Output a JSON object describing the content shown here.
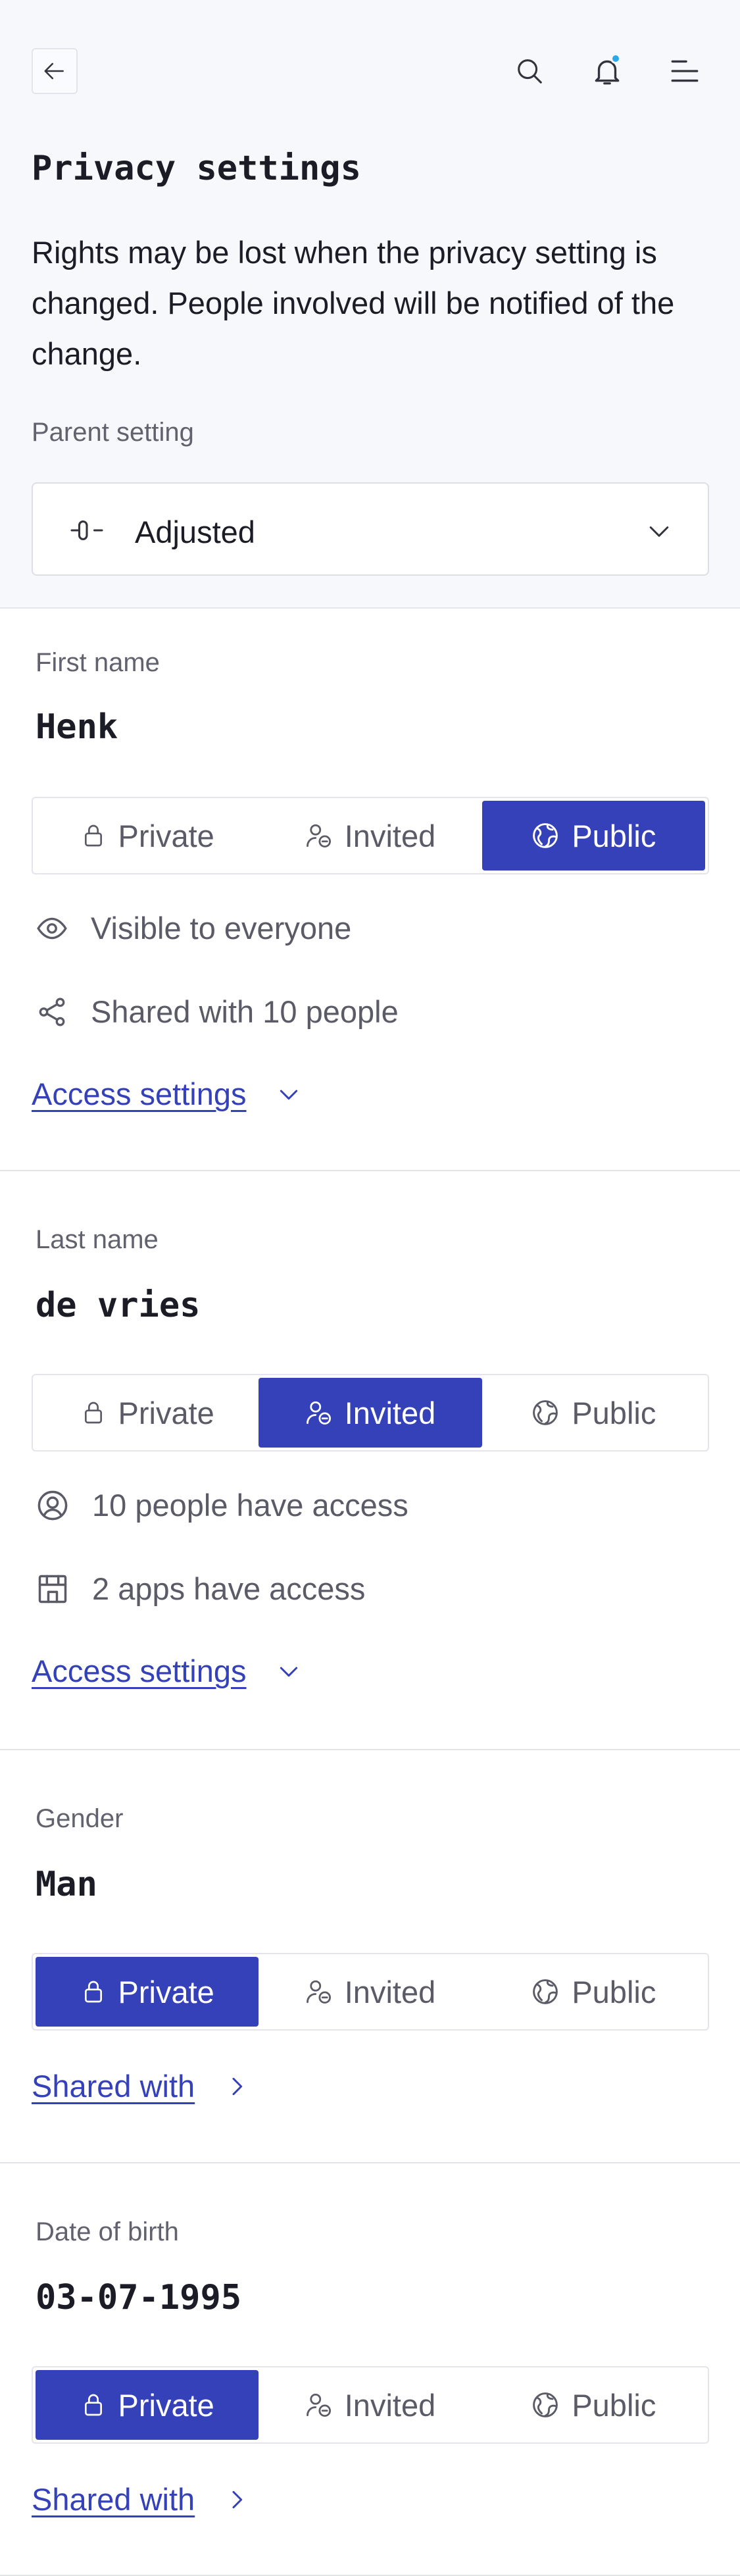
{
  "header": {
    "back_icon": "arrow-left-icon",
    "search_icon": "search-icon",
    "notifications_icon": "bell-icon",
    "menu_icon": "menu-icon",
    "notification_dot_color": "#2aa8e8"
  },
  "page": {
    "title": "Privacy settings",
    "intro": "Rights may be lost when the privacy setting is changed. People involved will be notified of the change.",
    "parent_setting_label": "Parent setting",
    "parent_setting_value": "Adjusted"
  },
  "colors": {
    "accent": "#3541b8",
    "text": "#1c1c26",
    "muted": "#5b5b67"
  },
  "segment_labels": {
    "private": "Private",
    "invited": "Invited",
    "public": "Public"
  },
  "sections": [
    {
      "label": "First name",
      "value": "Henk",
      "selected": "Public",
      "info": [
        "Visible to everyone",
        "Shared with 10 people"
      ],
      "link": "Access settings"
    },
    {
      "label": "Last name",
      "value": "de vries",
      "selected": "Invited",
      "info": [
        "10 people have access",
        "2 apps have access"
      ],
      "link": "Access settings"
    },
    {
      "label": "Gender",
      "value": "Man",
      "selected": "Private",
      "link": "Shared with"
    },
    {
      "label": "Date of birth",
      "value": "03-07-1995",
      "selected": "Private",
      "link": "Shared with"
    }
  ]
}
